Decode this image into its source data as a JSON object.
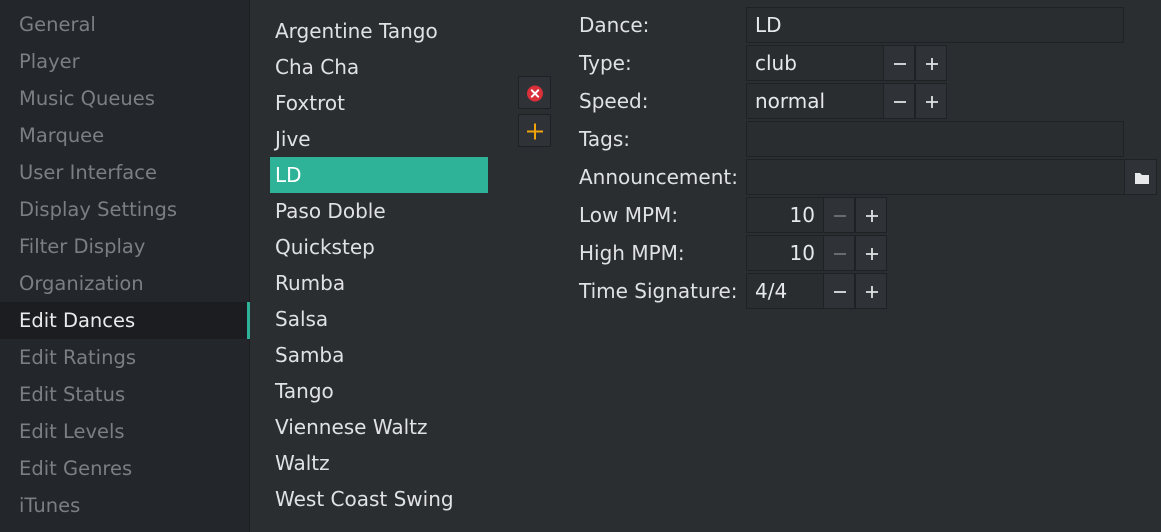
{
  "sidebar": {
    "items": [
      {
        "label": "General"
      },
      {
        "label": "Player"
      },
      {
        "label": "Music Queues"
      },
      {
        "label": "Marquee"
      },
      {
        "label": "User Interface"
      },
      {
        "label": "Display Settings"
      },
      {
        "label": "Filter Display"
      },
      {
        "label": "Organization"
      },
      {
        "label": "Edit Dances",
        "active": true
      },
      {
        "label": "Edit Ratings"
      },
      {
        "label": "Edit Status"
      },
      {
        "label": "Edit Levels"
      },
      {
        "label": "Edit Genres"
      },
      {
        "label": "iTunes"
      }
    ]
  },
  "dances": {
    "items": [
      {
        "label": "Argentine Tango"
      },
      {
        "label": "Cha Cha"
      },
      {
        "label": "Foxtrot"
      },
      {
        "label": "Jive"
      },
      {
        "label": "LD",
        "selected": true
      },
      {
        "label": "Paso Doble"
      },
      {
        "label": "Quickstep"
      },
      {
        "label": "Rumba"
      },
      {
        "label": "Salsa"
      },
      {
        "label": "Samba"
      },
      {
        "label": "Tango"
      },
      {
        "label": "Viennese Waltz"
      },
      {
        "label": "Waltz"
      },
      {
        "label": "West Coast Swing"
      }
    ],
    "actions": {
      "remove_icon": "remove-circle-icon",
      "add_icon": "plus-icon"
    }
  },
  "form": {
    "dance": {
      "label": "Dance:",
      "value": "LD"
    },
    "type": {
      "label": "Type:",
      "value": "club"
    },
    "speed": {
      "label": "Speed:",
      "value": "normal"
    },
    "tags": {
      "label": "Tags:",
      "value": ""
    },
    "announcement": {
      "label": "Announcement:",
      "value": ""
    },
    "low_mpm": {
      "label": "Low MPM:",
      "value": "10"
    },
    "high_mpm": {
      "label": "High MPM:",
      "value": "10"
    },
    "time_signature": {
      "label": "Time Signature:",
      "value": "4/4"
    }
  },
  "colors": {
    "accent": "#2eb398",
    "remove": "#d9303a",
    "add": "#f0a30a"
  }
}
